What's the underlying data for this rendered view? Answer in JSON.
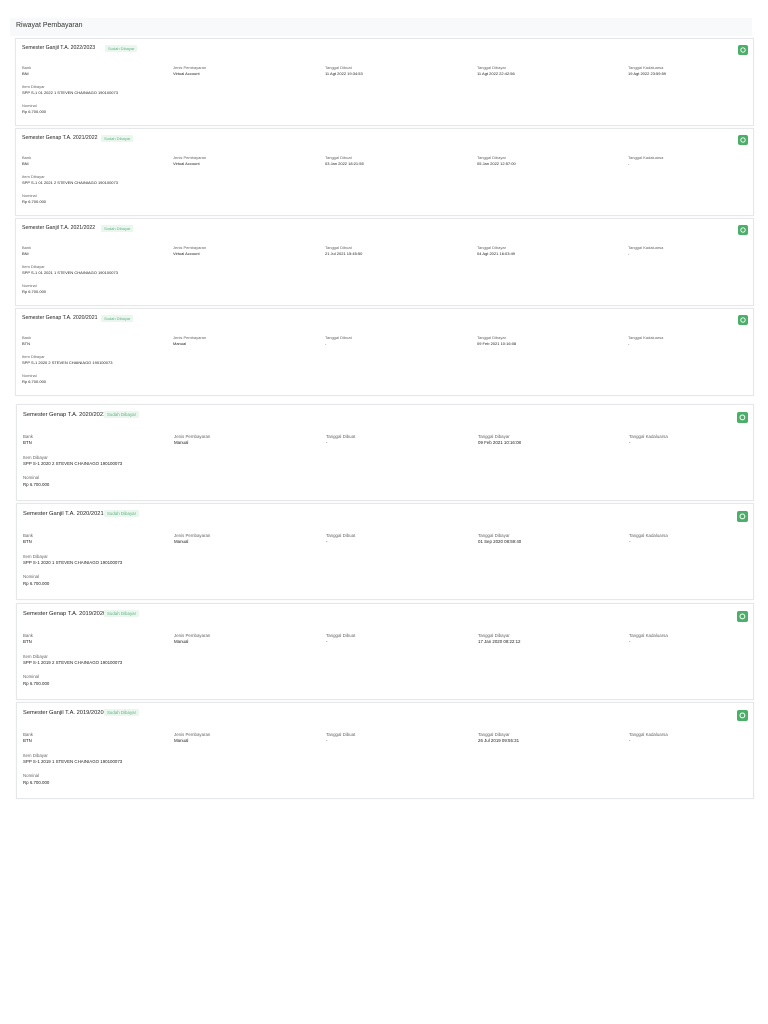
{
  "page": {
    "title": "Riwayat Pembayaran"
  },
  "labels": {
    "bank": "Bank",
    "jenis": "Jenis Pembayaran",
    "tanggal_dibuat": "Tanggal Dibuat",
    "tanggal_dibayar": "Tanggal Dibayar",
    "tanggal_kadaluarsa": "Tanggal Kadaluarsa",
    "item": "Item Dibayar",
    "nominal": "Nominal"
  },
  "status_badge": "Sudah Dibayar",
  "colors": {
    "accent": "#4caf69",
    "badge_text": "#66b384",
    "badge_bg": "#eaf7ef"
  },
  "icons": {
    "card_action": "refresh-icon"
  },
  "payments": [
    {
      "title": "Semester Ganjil T.A. 2022/2023",
      "bank": "BNI",
      "jenis": "Virtual Account",
      "tanggal_dibuat": "11 Agt 2022 19:34:53",
      "tanggal_dibayar": "11 Agt 2022 22:42:56",
      "tanggal_kadaluarsa": "19 Agt 2022 23:59:59",
      "item": "SPP S-1 01 2022 1 STEVEN CHAINIAGO 190100073",
      "nominal": "Rp 6.700.000"
    },
    {
      "title": "Semester Genap T.A. 2021/2022",
      "bank": "BNI",
      "jenis": "Virtual Account",
      "tanggal_dibuat": "03 Jan 2022 18:21:55",
      "tanggal_dibayar": "05 Jan 2022 12:57:00",
      "tanggal_kadaluarsa": "-",
      "item": "SPP S-1 01 2021 2 STEVEN CHAINIAGO 190100073",
      "nominal": "Rp 6.700.000"
    },
    {
      "title": "Semester Ganjil T.A. 2021/2022",
      "bank": "BNI",
      "jenis": "Virtual Account",
      "tanggal_dibuat": "21 Jul 2021 15:45:50",
      "tanggal_dibayar": "04 Agt 2021 16:03:49",
      "tanggal_kadaluarsa": "-",
      "item": "SPP S-1 01 2021 1 STEVEN CHAINIAGO 190100073",
      "nominal": "Rp 6.700.000"
    },
    {
      "title": "Semester Genap T.A. 2020/2021",
      "bank": "BTN",
      "jenis": "Manual",
      "tanggal_dibuat": "-",
      "tanggal_dibayar": "09 Feb 2021 10:16:08",
      "tanggal_kadaluarsa": "-",
      "item": "SPP S-1 2020 2 STEVEN CHAINIAGO 190100073",
      "nominal": "Rp 6.700.000"
    },
    {
      "title": "Semester Genap T.A. 2020/2021",
      "bank": "BTN",
      "jenis": "Manual",
      "tanggal_dibuat": "-",
      "tanggal_dibayar": "09 Feb 2021 10:16:08",
      "tanggal_kadaluarsa": "-",
      "item": "SPP S-1 2020 2 STEVEN CHAINIAGO 190100073",
      "nominal": "Rp 6.700.000"
    },
    {
      "title": "Semester Ganjil T.A. 2020/2021",
      "bank": "BTN",
      "jenis": "Manual",
      "tanggal_dibuat": "-",
      "tanggal_dibayar": "01 Sep 2020 08:59:40",
      "tanggal_kadaluarsa": "-",
      "item": "SPP S-1 2020 1 STEVEN CHAINIAGO 190100073",
      "nominal": "Rp 6.700.000"
    },
    {
      "title": "Semester Genap T.A. 2019/2020",
      "bank": "BTN",
      "jenis": "Manual",
      "tanggal_dibuat": "-",
      "tanggal_dibayar": "17 Jan 2020 08:22:12",
      "tanggal_kadaluarsa": "-",
      "item": "SPP S-1 2019 2 STEVEN CHAINIAGO 190100073",
      "nominal": "Rp 6.700.000"
    },
    {
      "title": "Semester Ganjil T.A. 2019/2020",
      "bank": "BTN",
      "jenis": "Manual",
      "tanggal_dibuat": "-",
      "tanggal_dibayar": "26 Jul 2019 09:55:31",
      "tanggal_kadaluarsa": "-",
      "item": "SPP S-1 2019 1 STEVEN CHAINIAGO 190100073",
      "nominal": "Rp 6.700.000"
    }
  ]
}
